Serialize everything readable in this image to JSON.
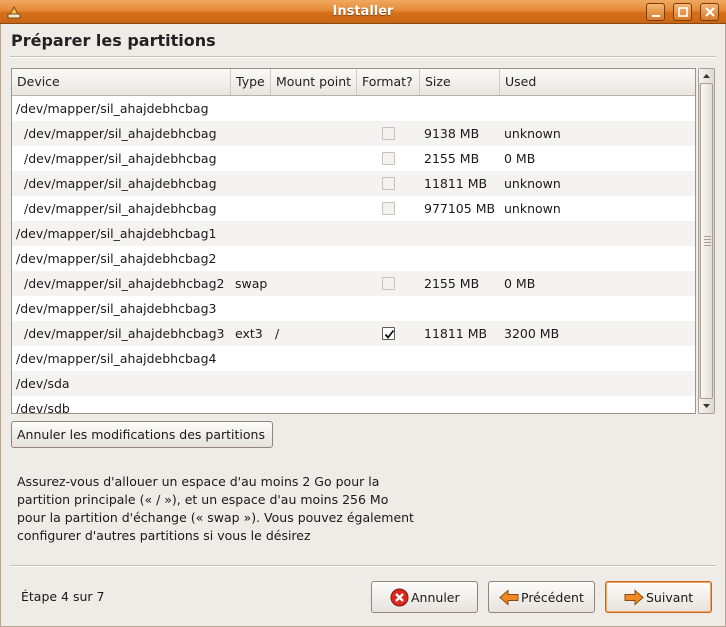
{
  "window": {
    "title": "Installer",
    "page_title": "Préparer les partitions"
  },
  "table": {
    "columns": [
      "Device",
      "Type",
      "Mount point",
      "Format?",
      "Size",
      "Used"
    ],
    "rows": [
      {
        "device": "/dev/mapper/sil_ahajdebhcbag",
        "indent": false,
        "type": "",
        "mount": "",
        "format": null,
        "size": "",
        "used": ""
      },
      {
        "device": "/dev/mapper/sil_ahajdebhcbag",
        "indent": true,
        "type": "",
        "mount": "",
        "format": false,
        "size": "9138 MB",
        "used": "unknown"
      },
      {
        "device": "/dev/mapper/sil_ahajdebhcbag",
        "indent": true,
        "type": "",
        "mount": "",
        "format": false,
        "size": "2155 MB",
        "used": "0 MB"
      },
      {
        "device": "/dev/mapper/sil_ahajdebhcbag",
        "indent": true,
        "type": "",
        "mount": "",
        "format": false,
        "size": "11811 MB",
        "used": "unknown"
      },
      {
        "device": "/dev/mapper/sil_ahajdebhcbag",
        "indent": true,
        "type": "",
        "mount": "",
        "format": false,
        "size": "977105 MB",
        "used": "unknown"
      },
      {
        "device": "/dev/mapper/sil_ahajdebhcbag1",
        "indent": false,
        "type": "",
        "mount": "",
        "format": null,
        "size": "",
        "used": ""
      },
      {
        "device": "/dev/mapper/sil_ahajdebhcbag2",
        "indent": false,
        "type": "",
        "mount": "",
        "format": null,
        "size": "",
        "used": ""
      },
      {
        "device": "/dev/mapper/sil_ahajdebhcbag2",
        "indent": true,
        "type": "swap",
        "mount": "",
        "format": false,
        "size": "2155 MB",
        "used": "0 MB"
      },
      {
        "device": "/dev/mapper/sil_ahajdebhcbag3",
        "indent": false,
        "type": "",
        "mount": "",
        "format": null,
        "size": "",
        "used": ""
      },
      {
        "device": "/dev/mapper/sil_ahajdebhcbag3",
        "indent": true,
        "type": "ext3",
        "mount": "/",
        "format": true,
        "size": "11811 MB",
        "used": "3200 MB"
      },
      {
        "device": "/dev/mapper/sil_ahajdebhcbag4",
        "indent": false,
        "type": "",
        "mount": "",
        "format": null,
        "size": "",
        "used": ""
      },
      {
        "device": "/dev/sda",
        "indent": false,
        "type": "",
        "mount": "",
        "format": null,
        "size": "",
        "used": ""
      },
      {
        "device": "/dev/sdb",
        "indent": false,
        "type": "",
        "mount": "",
        "format": null,
        "size": "",
        "used": ""
      }
    ]
  },
  "buttons": {
    "revert": "Annuler les modifications des partitions",
    "cancel": "Annuler",
    "back": "Précédent",
    "forward": "Suivant"
  },
  "description": "Assurez-vous d'allouer un espace d'au moins 2 Go pour la partition principale (« / »), et un espace d'au moins 256 Mo pour la partition d'échange (« swap »). Vous pouvez également configurer d'autres partitions si vous le désirez",
  "step": "Étape 4 sur 7",
  "colors": {
    "titlebar": "#e58a36",
    "focus": "#c8661a",
    "cancel_icon": "#d8281f",
    "arrow_icon": "#f08a24"
  }
}
